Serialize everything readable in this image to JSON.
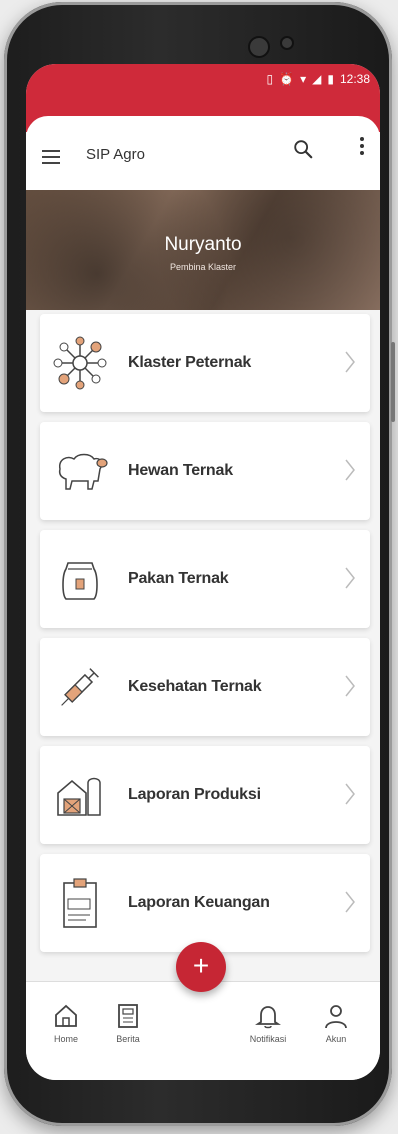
{
  "status_bar": {
    "time": "12:38"
  },
  "app_bar": {
    "title": "SIP Agro"
  },
  "profile": {
    "name": "Nuryanto",
    "role": "Pembina Klaster"
  },
  "menu": {
    "items": [
      {
        "label": "Klaster Peternak",
        "icon": "cluster-icon"
      },
      {
        "label": "Hewan Ternak",
        "icon": "sheep-icon"
      },
      {
        "label": "Pakan Ternak",
        "icon": "feed-bag-icon"
      },
      {
        "label": "Kesehatan Ternak",
        "icon": "syringe-icon"
      },
      {
        "label": "Laporan Produksi",
        "icon": "barn-icon"
      },
      {
        "label": "Laporan Keuangan",
        "icon": "clipboard-icon"
      }
    ]
  },
  "bottom_nav": {
    "home": "Home",
    "berita": "Berita",
    "fab": "+",
    "notifikasi": "Notifikasi",
    "akun": "Akun"
  },
  "colors": {
    "primary": "#cf2a3a",
    "accent_orange": "#e3a37a"
  }
}
